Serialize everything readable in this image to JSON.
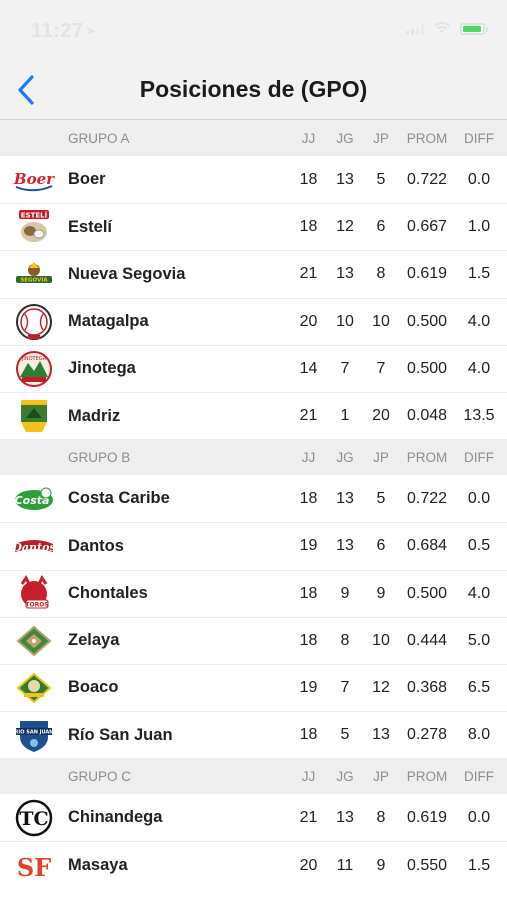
{
  "status_bar": {
    "time": "11:27",
    "location_icon": "location-arrow-icon"
  },
  "nav": {
    "back_icon": "chevron-left-icon",
    "title": "Posiciones de (GPO)"
  },
  "columns": {
    "jj": "JJ",
    "jg": "JG",
    "jp": "JP",
    "prom": "PROM",
    "diff": "DIFF"
  },
  "colors": {
    "accent": "#1a7cf5",
    "group_header_bg": "#eeeeef",
    "group_header_text": "#8e8e93"
  },
  "groups": [
    {
      "name": "GRUPO A",
      "teams": [
        {
          "name": "Boer",
          "jj": "18",
          "jg": "13",
          "jp": "5",
          "prom": "0.722",
          "diff": "0.0",
          "logo": "boer-logo-icon"
        },
        {
          "name": "Estelí",
          "jj": "18",
          "jg": "12",
          "jp": "6",
          "prom": "0.667",
          "diff": "1.0",
          "logo": "esteli-logo-icon"
        },
        {
          "name": "Nueva Segovia",
          "jj": "21",
          "jg": "13",
          "jp": "8",
          "prom": "0.619",
          "diff": "1.5",
          "logo": "nueva-segovia-logo-icon"
        },
        {
          "name": "Matagalpa",
          "jj": "20",
          "jg": "10",
          "jp": "10",
          "prom": "0.500",
          "diff": "4.0",
          "logo": "matagalpa-logo-icon"
        },
        {
          "name": "Jinotega",
          "jj": "14",
          "jg": "7",
          "jp": "7",
          "prom": "0.500",
          "diff": "4.0",
          "logo": "jinotega-logo-icon"
        },
        {
          "name": "Madriz",
          "jj": "21",
          "jg": "1",
          "jp": "20",
          "prom": "0.048",
          "diff": "13.5",
          "logo": "madriz-logo-icon"
        }
      ]
    },
    {
      "name": "GRUPO B",
      "teams": [
        {
          "name": "Costa Caribe",
          "jj": "18",
          "jg": "13",
          "jp": "5",
          "prom": "0.722",
          "diff": "0.0",
          "logo": "costa-caribe-logo-icon"
        },
        {
          "name": "Dantos",
          "jj": "19",
          "jg": "13",
          "jp": "6",
          "prom": "0.684",
          "diff": "0.5",
          "logo": "dantos-logo-icon"
        },
        {
          "name": "Chontales",
          "jj": "18",
          "jg": "9",
          "jp": "9",
          "prom": "0.500",
          "diff": "4.0",
          "logo": "chontales-logo-icon"
        },
        {
          "name": "Zelaya",
          "jj": "18",
          "jg": "8",
          "jp": "10",
          "prom": "0.444",
          "diff": "5.0",
          "logo": "zelaya-logo-icon"
        },
        {
          "name": "Boaco",
          "jj": "19",
          "jg": "7",
          "jp": "12",
          "prom": "0.368",
          "diff": "6.5",
          "logo": "boaco-logo-icon"
        },
        {
          "name": "Río San Juan",
          "jj": "18",
          "jg": "5",
          "jp": "13",
          "prom": "0.278",
          "diff": "8.0",
          "logo": "rio-san-juan-logo-icon"
        }
      ]
    },
    {
      "name": "GRUPO C",
      "teams": [
        {
          "name": "Chinandega",
          "jj": "21",
          "jg": "13",
          "jp": "8",
          "prom": "0.619",
          "diff": "0.0",
          "logo": "chinandega-logo-icon"
        },
        {
          "name": "Masaya",
          "jj": "20",
          "jg": "11",
          "jp": "9",
          "prom": "0.550",
          "diff": "1.5",
          "logo": "masaya-logo-icon"
        }
      ]
    }
  ]
}
